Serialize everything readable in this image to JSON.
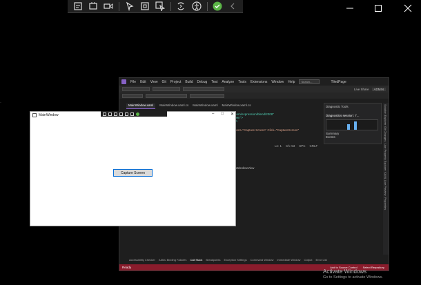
{
  "debug_toolbar": {
    "icons": [
      "live-visual-tree-icon",
      "select-element-icon",
      "video-icon",
      "select-in-app-icon",
      "display-layout-adorners-icon",
      "track-focus-icon",
      "hot-reload-icon",
      "accessibility-icon",
      "check-icon",
      "collapse-icon"
    ]
  },
  "vs": {
    "menu": [
      "File",
      "Edit",
      "View",
      "Git",
      "Project",
      "Build",
      "Debug",
      "Test",
      "Analyze",
      "Tools",
      "Extensions",
      "Window",
      "Help"
    ],
    "search": "Search...",
    "solution": "TiledPage",
    "live_share": "Live Share",
    "admin": "ADMIN",
    "tabs": [
      "MainWindow.xaml",
      "MainWindow.xaml.cs",
      "MainWindow.xaml",
      "MainWindow.xaml.cs"
    ],
    "code_lines": [
      "...x.com/expression/blend/2008\"",
      "...Open\">",
      "...ne>",
      "Content=\"Capture Screen\" Click=\"CaptureScreen\""
    ],
    "editor_status": [
      "Ln: 1",
      "Ch: 53",
      "SPC",
      "CRLF"
    ],
    "diagnostics": {
      "title": "Diagnostic Tools",
      "session": "Diagnostics session: 7...",
      "tabs": [
        "Summary",
        "Events"
      ],
      "events_label": "Events"
    },
    "output_header": "MainWindowView",
    "bottom_tabs": [
      "Accessibility Checker",
      "XAML Binding Failures",
      "Call Stack",
      "Breakpoints",
      "Exception Settings",
      "Command Window",
      "Immediate Window",
      "Output",
      "Error List"
    ],
    "status_left": "Ready",
    "status_right": [
      "Add to Source Control",
      "Select Repository"
    ],
    "right_rail": [
      "Solution Explorer",
      "Git Changes",
      "Live Property Explorer",
      "XAML Live Preview",
      "Properties"
    ]
  },
  "app": {
    "title": "MainWindow",
    "capture_button": "Capture Screen"
  },
  "watermark": {
    "line1": "Activate Windows",
    "line2": "Go to Settings to activate Windows."
  }
}
